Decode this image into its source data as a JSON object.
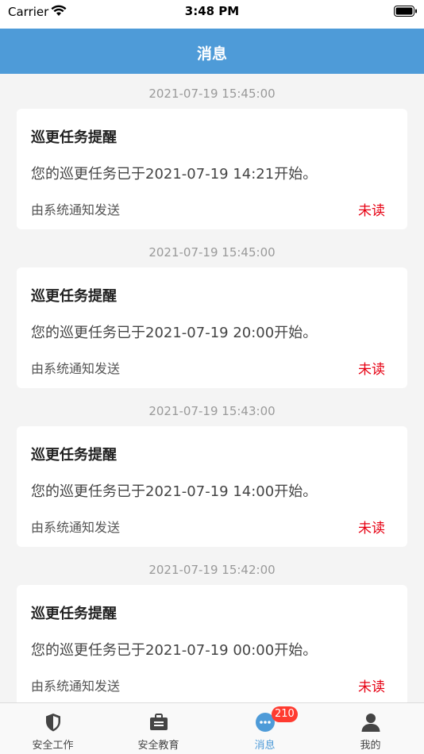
{
  "status_bar": {
    "carrier": "Carrier",
    "time": "3:48 PM"
  },
  "header": {
    "title": "消息"
  },
  "messages": [
    {
      "time": "2021-07-19 15:45:00",
      "title": "巡更任务提醒",
      "body": "您的巡更任务已于2021-07-19 14:21开始。",
      "sender": "由系统通知发送",
      "status": "未读"
    },
    {
      "time": "2021-07-19 15:45:00",
      "title": "巡更任务提醒",
      "body": "您的巡更任务已于2021-07-19 20:00开始。",
      "sender": "由系统通知发送",
      "status": "未读"
    },
    {
      "time": "2021-07-19 15:43:00",
      "title": "巡更任务提醒",
      "body": "您的巡更任务已于2021-07-19 14:00开始。",
      "sender": "由系统通知发送",
      "status": "未读"
    },
    {
      "time": "2021-07-19 15:42:00",
      "title": "巡更任务提醒",
      "body": "您的巡更任务已于2021-07-19 00:00开始。",
      "sender": "由系统通知发送",
      "status": "未读"
    }
  ],
  "tab_bar": {
    "tabs": [
      {
        "label": "安全工作",
        "icon": "shield-icon"
      },
      {
        "label": "安全教育",
        "icon": "briefcase-icon"
      },
      {
        "label": "消息",
        "icon": "chat-bubble-icon",
        "badge": "210",
        "active": true
      },
      {
        "label": "我的",
        "icon": "user-icon"
      }
    ]
  },
  "colors": {
    "accent": "#4e9bd8",
    "unread": "#e60012",
    "badge": "#ff3b30"
  }
}
